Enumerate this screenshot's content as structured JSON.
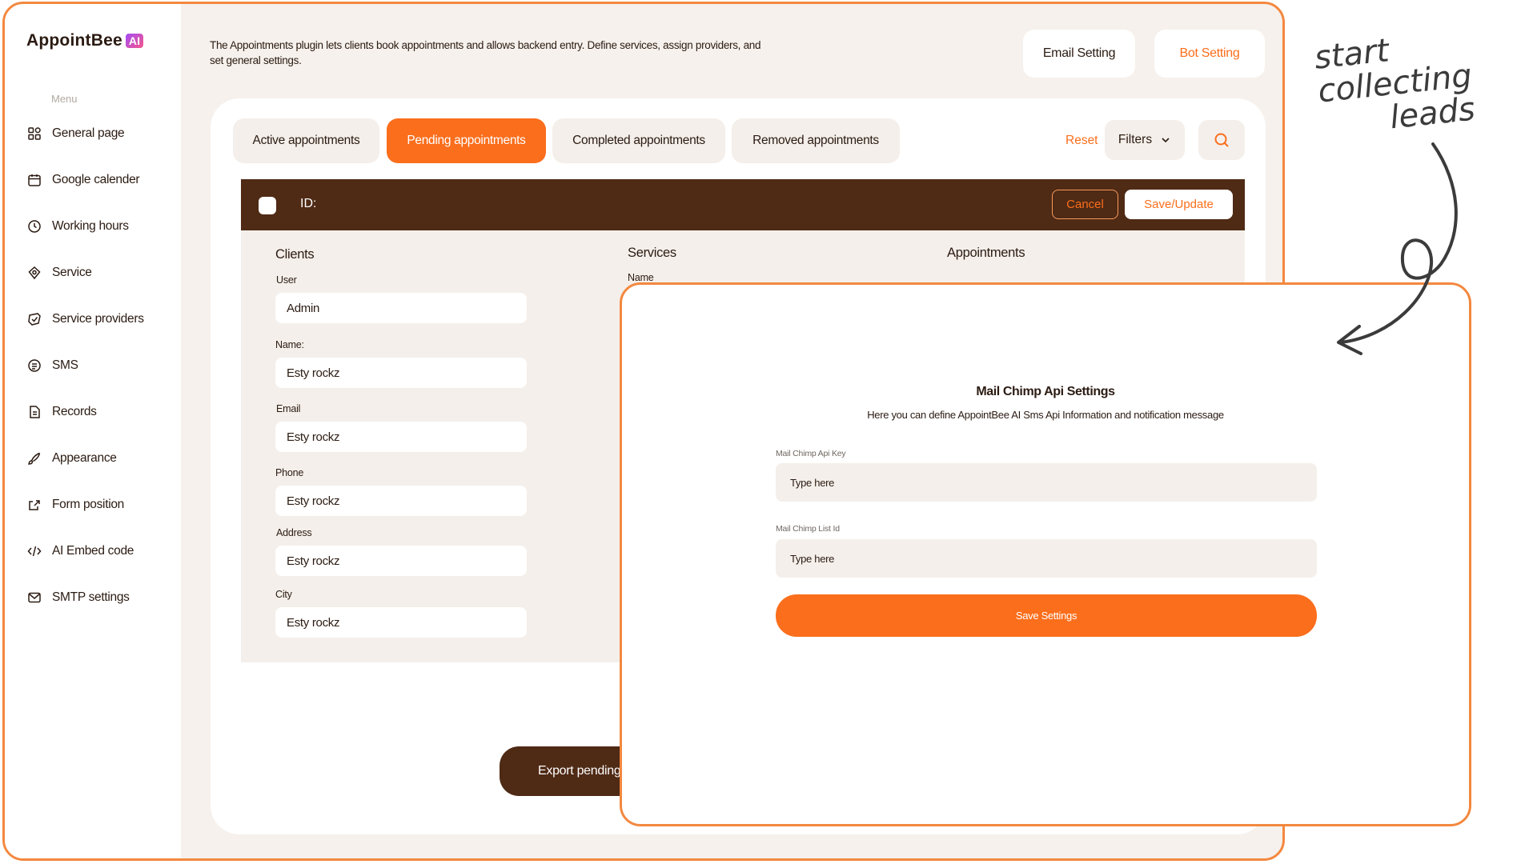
{
  "brand": {
    "name": "AppointBee",
    "badge": "AI"
  },
  "sidebar": {
    "menu_title": "Menu",
    "items": [
      {
        "label": "General page",
        "icon": "grid-icon"
      },
      {
        "label": "Google calender",
        "icon": "calendar-icon"
      },
      {
        "label": "Working hours",
        "icon": "clock-icon"
      },
      {
        "label": "Service",
        "icon": "service-icon"
      },
      {
        "label": "Service providers",
        "icon": "shield-check-icon"
      },
      {
        "label": "SMS",
        "icon": "sms-icon"
      },
      {
        "label": "Records",
        "icon": "document-icon"
      },
      {
        "label": "Appearance",
        "icon": "brush-icon"
      },
      {
        "label": "Form position",
        "icon": "share-icon"
      },
      {
        "label": "AI Embed code",
        "icon": "code-icon"
      },
      {
        "label": "SMTP settings",
        "icon": "mail-icon"
      }
    ]
  },
  "header": {
    "intro": "The Appointments plugin lets clients book appointments and allows backend entry. Define services, assign providers, and set general settings.",
    "email_setting": "Email Setting",
    "bot_setting": "Bot Setting"
  },
  "tabs": [
    "Active appointments",
    "Pending appointments",
    "Completed appointments",
    "Removed appointments"
  ],
  "active_tab": "Pending appointments",
  "toolbar": {
    "reset": "Reset",
    "filters": "Filters"
  },
  "record_bar": {
    "id_label": "ID:",
    "cancel": "Cancel",
    "save_update": "Save/Update"
  },
  "form": {
    "clients_heading": "Clients",
    "services_heading": "Services",
    "appointments_heading": "Appointments",
    "services_name_label": "Name",
    "fields": [
      {
        "label": "User",
        "value": "Admin"
      },
      {
        "label": "Name:",
        "value": "Esty rockz"
      },
      {
        "label": "Email",
        "value": "Esty rockz"
      },
      {
        "label": "Phone",
        "value": "Esty rockz"
      },
      {
        "label": "Address",
        "value": "Esty rockz"
      },
      {
        "label": "City",
        "value": "Esty rockz"
      }
    ]
  },
  "export_button": "Export pending a",
  "modal": {
    "title": "Mail Chimp Api Settings",
    "subtitle": "Here you can define AppointBee AI Sms Api Information and notification message",
    "api_key_label": "Mail Chimp Api Key",
    "api_key_placeholder": "Type here",
    "list_id_label": "Mail Chimp List Id",
    "list_id_placeholder": "Type here",
    "save": "Save Settings"
  },
  "annotation": {
    "line1": "start collecting",
    "line2": "leads"
  },
  "colors": {
    "accent": "#fa6e1c",
    "dark": "#4f2a15",
    "border": "#f3883f",
    "bg": "#f6f1ec"
  }
}
